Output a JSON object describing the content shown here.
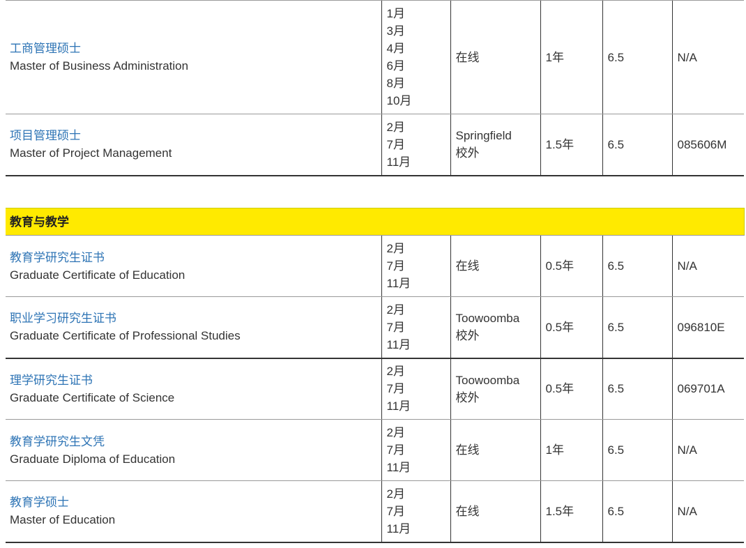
{
  "business_rows": [
    {
      "name_zh": "工商管理硕士",
      "name_en": "Master of Business Administration",
      "intakes": [
        "1月",
        "3月",
        "4月",
        "6月",
        "8月",
        "10月"
      ],
      "mode": [
        "在线"
      ],
      "duration": "1年",
      "ielts": "6.5",
      "code": "N/A"
    },
    {
      "name_zh": "项目管理硕士",
      "name_en": "Master of Project Management",
      "intakes": [
        "2月",
        "7月",
        "11月"
      ],
      "mode": [
        "Springfield",
        "校外"
      ],
      "duration": "1.5年",
      "ielts": "6.5",
      "code": "085606M"
    }
  ],
  "education_section": {
    "title": "教育与教学",
    "rows": [
      {
        "name_zh": "教育学研究生证书",
        "name_en": "Graduate Certificate of Education",
        "intakes": [
          "2月",
          "7月",
          "11月"
        ],
        "mode": [
          "在线"
        ],
        "duration": "0.5年",
        "ielts": "6.5",
        "code": "N/A"
      },
      {
        "name_zh": "职业学习研究生证书",
        "name_en": "Graduate Certificate of Professional Studies",
        "intakes": [
          "2月",
          "7月",
          "11月"
        ],
        "mode": [
          "Toowoomba",
          "校外"
        ],
        "duration": "0.5年",
        "ielts": "6.5",
        "code": "096810E"
      },
      {
        "name_zh": "理学研究生证书",
        "name_en": "Graduate Certificate of Science",
        "intakes": [
          "2月",
          "7月",
          "11月"
        ],
        "mode": [
          "Toowoomba",
          "校外"
        ],
        "duration": "0.5年",
        "ielts": "6.5",
        "code": "069701A"
      },
      {
        "name_zh": "教育学研究生文凭",
        "name_en": "Graduate Diploma of Education",
        "intakes": [
          "2月",
          "7月",
          "11月"
        ],
        "mode": [
          "在线"
        ],
        "duration": "1年",
        "ielts": "6.5",
        "code": "N/A"
      },
      {
        "name_zh": "教育学硕士",
        "name_en": "Master of Education",
        "intakes": [
          "2月",
          "7月",
          "11月"
        ],
        "mode": [
          "在线"
        ],
        "duration": "1.5年",
        "ielts": "6.5",
        "code": "N/A"
      }
    ]
  }
}
